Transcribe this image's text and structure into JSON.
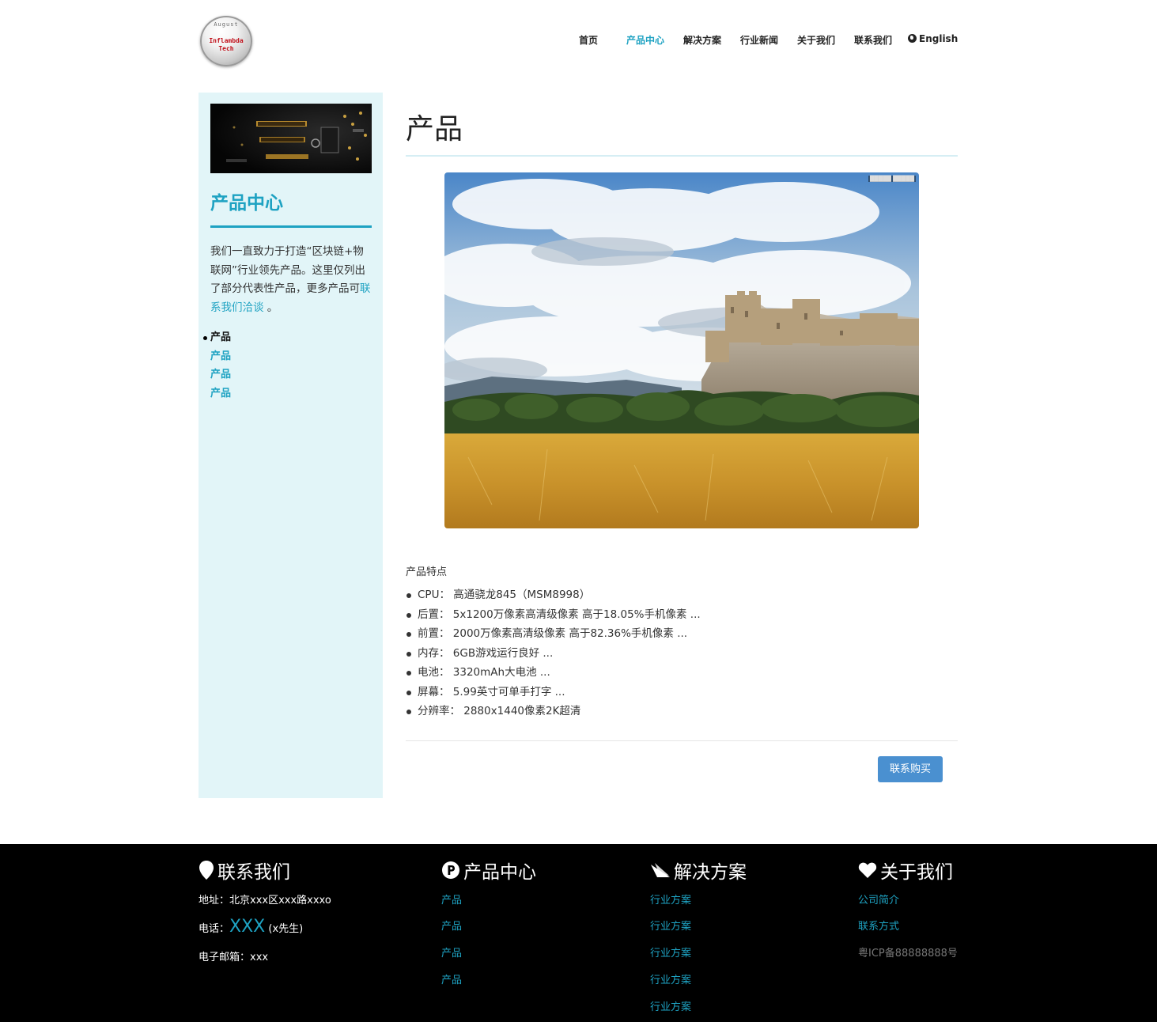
{
  "header": {
    "logo": {
      "line1": "August",
      "line2": "Inflambda",
      "line3": "Tech"
    },
    "nav": [
      {
        "label": "首页",
        "active": false
      },
      {
        "label": "产品中心",
        "active": true
      },
      {
        "label": "解决方案",
        "active": false
      },
      {
        "label": "行业新闻",
        "active": false
      },
      {
        "label": "关于我们",
        "active": false
      },
      {
        "label": "联系我们",
        "active": false
      },
      {
        "label": "English",
        "icon": "globe-icon",
        "active": false
      }
    ]
  },
  "sidebar": {
    "title": "产品中心",
    "description": "我们一直致力于打造“区块链+物联网”行业领先产品。这里仅列出了部分代表性产品，更多产品可",
    "description_link": "联系我们洽谈",
    "description_end": "。",
    "items": [
      {
        "label": "产品",
        "active": true
      },
      {
        "label": "产品",
        "active": false
      },
      {
        "label": "产品",
        "active": false
      },
      {
        "label": "产品",
        "active": false
      }
    ]
  },
  "main": {
    "title": "产品",
    "features_heading": "产品特点",
    "features": [
      "CPU： 高通骁龙845（MSM8998）",
      "后置： 5x1200万像素高清级像素 高于18.05%手机像素 ...",
      "前置： 2000万像素高清级像素 高于82.36%手机像素 ...",
      "内存： 6GB游戏运行良好 ...",
      "电池： 3320mAh大电池 ...",
      "屏幕： 5.99英寸可单手打字 ...",
      "分辨率： 2880x1440像素2K超清"
    ],
    "buy_button": "联系购买"
  },
  "footer": {
    "contact": {
      "title": "联系我们",
      "icon": "map-marker-icon",
      "address": "地址：北京xxx区xxx路xxxo",
      "phone_label": "电话：",
      "phone_number": "XXX",
      "phone_suffix": "(x先生)",
      "email": "电子邮箱：xxx"
    },
    "products": {
      "title": "产品中心",
      "icon": "parking-icon",
      "links": [
        "产品",
        "产品",
        "产品",
        "产品"
      ]
    },
    "solutions": {
      "title": "解决方案",
      "icon": "paper-plane-icon",
      "links": [
        "行业方案",
        "行业方案",
        "行业方案",
        "行业方案",
        "行业方案"
      ]
    },
    "about": {
      "title": "关于我们",
      "icon": "heart-icon",
      "links": [
        "公司简介",
        "联系方式"
      ],
      "icp": "粤ICP备88888888号"
    }
  },
  "colors": {
    "accent": "#1ea2c2",
    "sidebar_bg": "#e2f5f8",
    "button": "#4a90d0",
    "footer_bg": "#000000"
  }
}
